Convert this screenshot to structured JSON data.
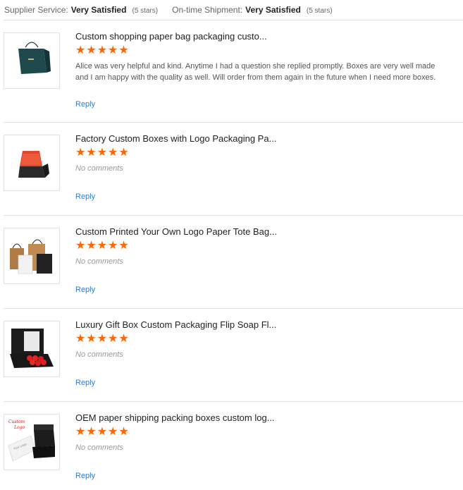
{
  "summary": {
    "supplier_service_label": "Supplier Service:",
    "supplier_service_value": "Very Satisfied",
    "supplier_service_stars": "(5 stars)",
    "shipment_label": "On-time Shipment:",
    "shipment_value": "Very Satisfied",
    "shipment_stars": "(5 stars)"
  },
  "colors": {
    "star": "#ff6600",
    "link": "#2d7cd4",
    "divider": "#e1e1e1"
  },
  "reviews": [
    {
      "title": "Custom shopping paper bag packaging custo...",
      "rating": 5,
      "comment": "Alice was very helpful and kind. Anytime I had a question she replied promptly. Boxes are very well made and I am happy with the quality as well. Will order from them again in the future when I need more boxes.",
      "reply": "Reply"
    },
    {
      "title": "Factory Custom Boxes with Logo Packaging Pa...",
      "rating": 5,
      "comment": "No comments",
      "reply": "Reply"
    },
    {
      "title": "Custom Printed Your Own Logo Paper Tote Bag...",
      "rating": 5,
      "comment": "No comments",
      "reply": "Reply"
    },
    {
      "title": "Luxury Gift Box Custom Packaging Flip Soap Fl...",
      "rating": 5,
      "comment": "No comments",
      "reply": "Reply"
    },
    {
      "title": "OEM paper shipping packing boxes custom log...",
      "rating": 5,
      "comment": "No comments",
      "reply": "Reply",
      "thumb_text_1": "Custom",
      "thumb_text_2": "Logo",
      "thumb_text_3": "Your Logo"
    }
  ]
}
